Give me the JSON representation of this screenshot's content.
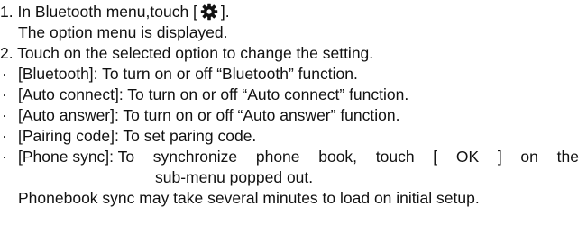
{
  "steps": {
    "step1_prefix": "1. In Bluetooth menu,touch [",
    "step1_suffix": "].",
    "step1_note": "The option menu is displayed.",
    "step2": "2. Touch on the selected option to change the setting."
  },
  "icon": "settings-gear-icon",
  "bullet_char": "·",
  "options": [
    {
      "text": "[Bluetooth]: To turn on or off “Bluetooth” function."
    },
    {
      "text": "[Auto connect]: To turn on or off “Auto connect” function."
    },
    {
      "text": "[Auto answer]: To turn on or off “Auto answer” function."
    },
    {
      "text": "[Pairing code]: To set paring code."
    }
  ],
  "phone_sync": {
    "words": [
      "[Phone sync]: To",
      "synchronize",
      "phone",
      "book,",
      "touch",
      "[",
      "OK",
      "]",
      "on",
      "the"
    ],
    "continuation": "sub-menu popped out.",
    "note": "Phonebook sync may take several minutes to load on initial setup."
  }
}
